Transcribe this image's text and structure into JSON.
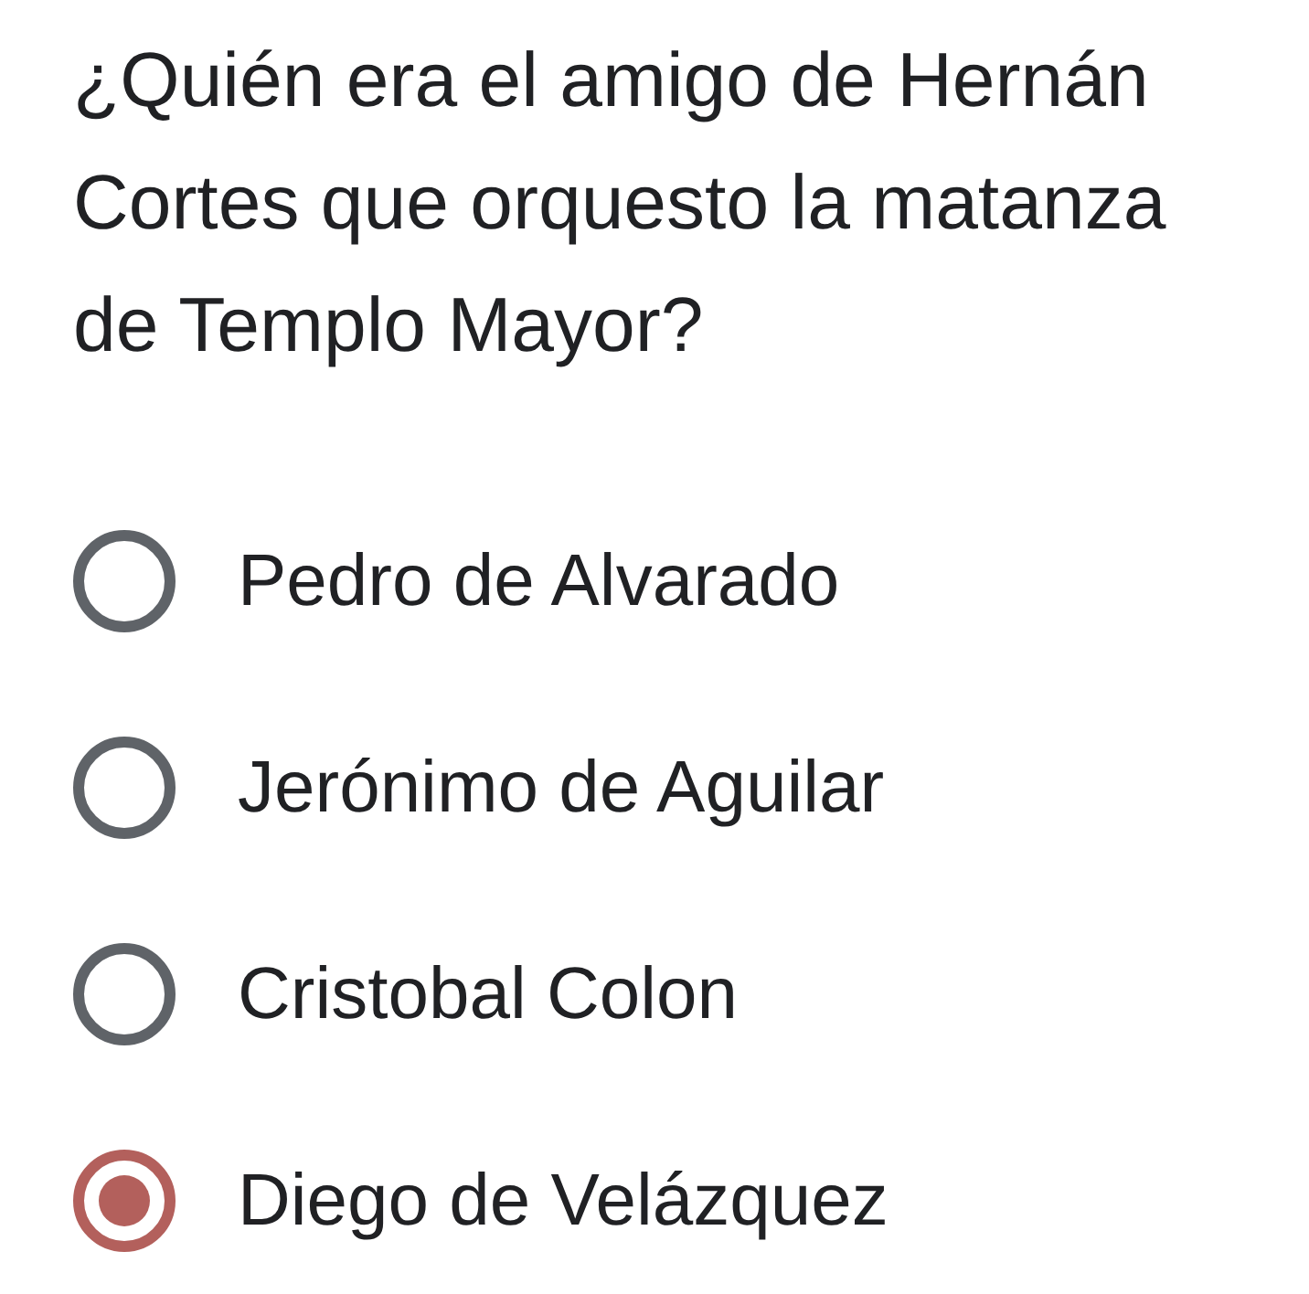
{
  "question": "¿Quién era el amigo de Hernán Cortes que orquesto la matanza de Templo Mayor?",
  "options": [
    {
      "label": "Pedro de Alvarado",
      "selected": false
    },
    {
      "label": "Jerónimo de Aguilar",
      "selected": false
    },
    {
      "label": "Cristobal Colon",
      "selected": false
    },
    {
      "label": "Diego de Velázquez",
      "selected": true
    }
  ]
}
